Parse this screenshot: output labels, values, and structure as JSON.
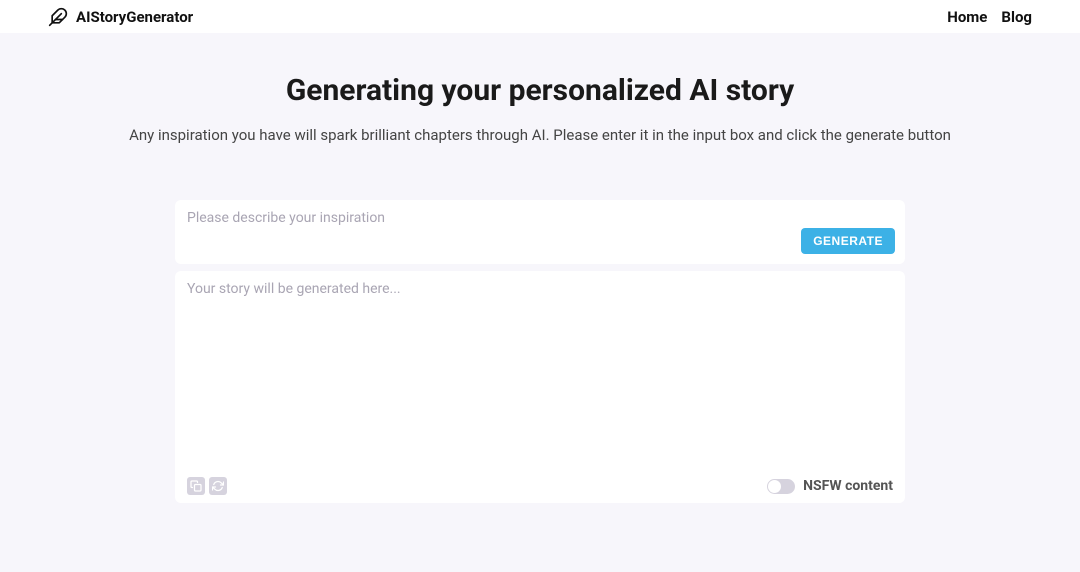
{
  "header": {
    "brand": "AIStoryGenerator",
    "nav": {
      "home": "Home",
      "blog": "Blog"
    }
  },
  "main": {
    "title": "Generating your personalized AI story",
    "subtitle": "Any inspiration you have will spark brilliant chapters through AI. Please enter it in the input box and click the generate button",
    "input_placeholder": "Please describe your inspiration",
    "generate_label": "GENERATE",
    "output_placeholder": "Your story will be generated here...",
    "nsfw_label": "NSFW content"
  }
}
